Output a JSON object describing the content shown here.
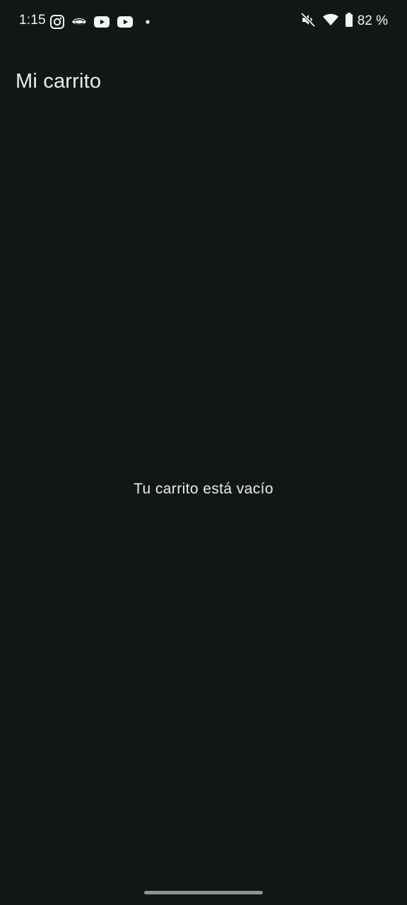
{
  "status_bar": {
    "time": "1:15",
    "notification_icons": [
      "instagram-icon",
      "app-eye-icon",
      "youtube-icon",
      "youtube-icon",
      "more-dot-icon"
    ],
    "system_icons": [
      "mute-icon",
      "wifi-icon",
      "battery-icon"
    ],
    "battery_percent": "82 %"
  },
  "header": {
    "title": "Mi carrito"
  },
  "main": {
    "empty_message": "Tu carrito está vacío"
  },
  "colors": {
    "background": "#111715",
    "text": "#e9eeeb",
    "nav_handle": "#8f9592"
  }
}
